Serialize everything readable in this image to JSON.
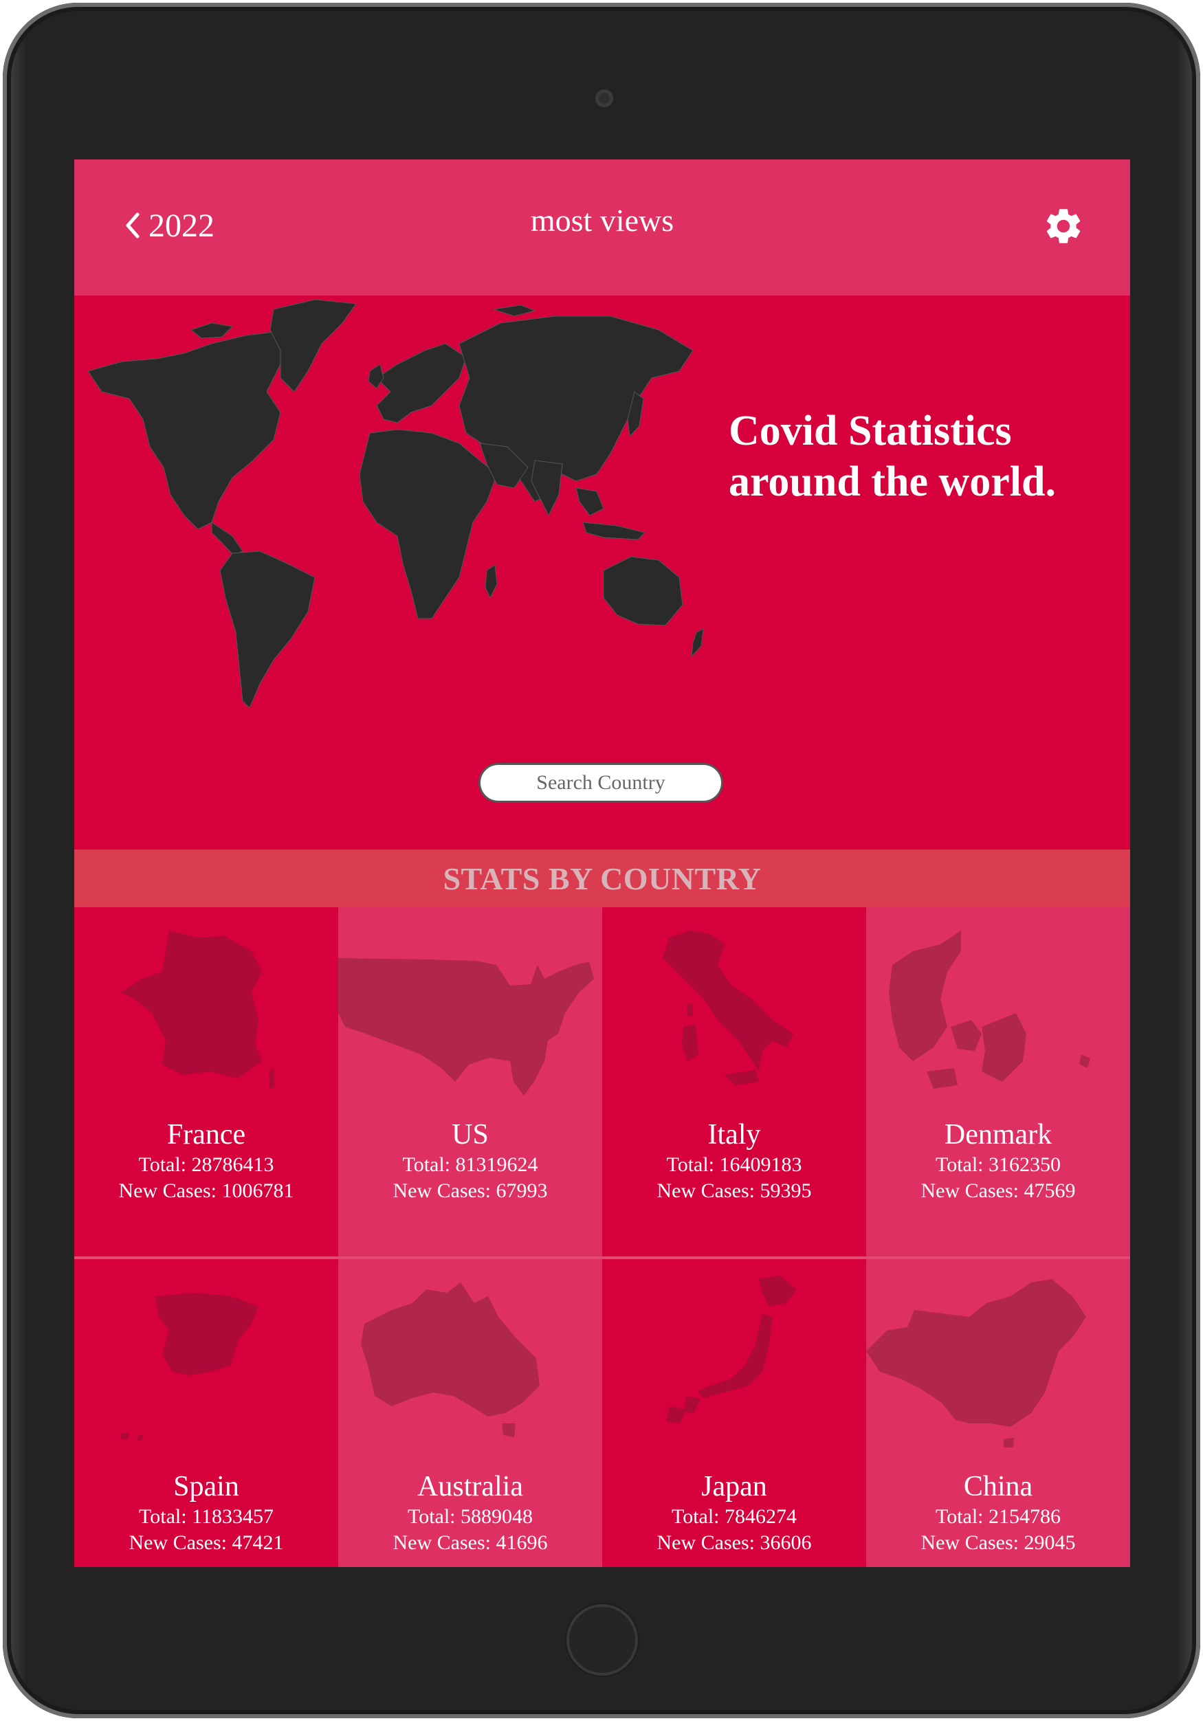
{
  "header": {
    "back_label": "2022",
    "title": "most views"
  },
  "hero": {
    "title_line1": "Covid Statistics",
    "title_line2": "around the world.",
    "search_placeholder": "Search Country"
  },
  "section": {
    "title": "STATS BY COUNTRY"
  },
  "countries": [
    {
      "name": "France",
      "total": "Total: 28786413",
      "new_cases": "New Cases: 1006781"
    },
    {
      "name": "US",
      "total": "Total: 81319624",
      "new_cases": "New Cases: 67993"
    },
    {
      "name": "Italy",
      "total": "Total: 16409183",
      "new_cases": "New Cases: 59395"
    },
    {
      "name": "Denmark",
      "total": "Total: 3162350",
      "new_cases": "New Cases: 47569"
    },
    {
      "name": "Spain",
      "total": "Total: 11833457",
      "new_cases": "New Cases: 47421"
    },
    {
      "name": "Australia",
      "total": "Total: 5889048",
      "new_cases": "New Cases: 41696"
    },
    {
      "name": "Japan",
      "total": "Total: 7846274",
      "new_cases": "New Cases: 36606"
    },
    {
      "name": "China",
      "total": "Total: 2154786",
      "new_cases": "New Cases: 29045"
    }
  ],
  "colors": {
    "primary": "#d5003c",
    "header": "#de3062",
    "section_bar": "#da3d50",
    "map": "#2a2a2a",
    "country_shape": "#ad0a39"
  },
  "icons": {
    "back": "chevron-left-icon",
    "settings": "gear-icon"
  }
}
